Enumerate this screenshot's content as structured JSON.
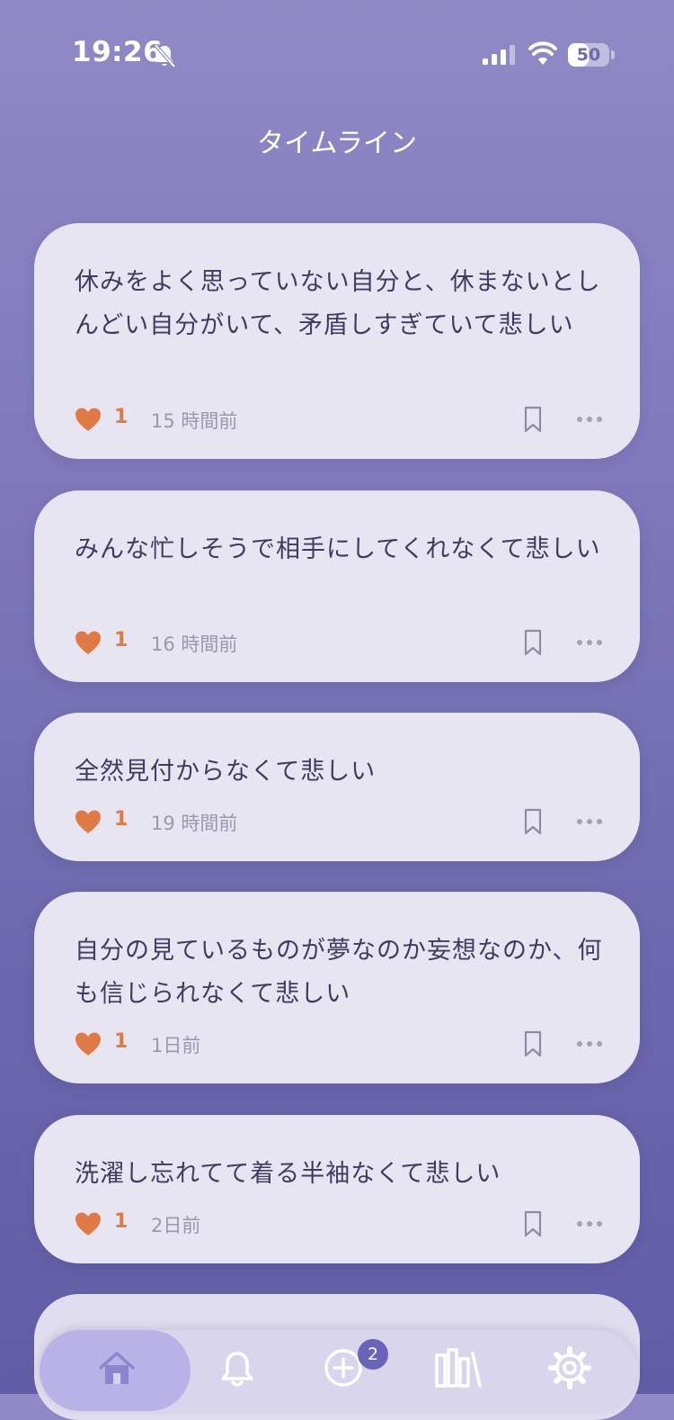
{
  "status_bar": {
    "time": "19:26",
    "battery": "50",
    "battery_level": 0.5,
    "icons": [
      "bell-off-icon",
      "signal-icon",
      "wifi-icon",
      "battery-icon"
    ]
  },
  "header": {
    "title": "タイムライン"
  },
  "posts": [
    {
      "text": "休みをよく思っていない自分と、休まないとしんどい自分がいて、矛盾しすぎていて悲しい",
      "likes": "1",
      "time": "15 時間前"
    },
    {
      "text": "みんな忙しそうで相手にしてくれなくて悲しい",
      "likes": "1",
      "time": "16 時間前"
    },
    {
      "text": "全然見付からなくて悲しい",
      "likes": "1",
      "time": "19 時間前"
    },
    {
      "text": "自分の見ているものが夢なのか妄想なのか、何も信じられなくて悲しい",
      "likes": "1",
      "time": "1日前"
    },
    {
      "text": "洗濯し忘れてて着る半袖なくて悲しい",
      "likes": "1",
      "time": "2日前"
    }
  ],
  "tab_bar": {
    "items": [
      "home-icon",
      "bell-icon",
      "plus-circle-icon",
      "library-icon",
      "gear-icon"
    ],
    "badge": "2"
  },
  "colors": {
    "accent": "#e07a45",
    "card": "#e8e5f2",
    "text": "#3e3c60",
    "muted": "#9a98ac"
  }
}
